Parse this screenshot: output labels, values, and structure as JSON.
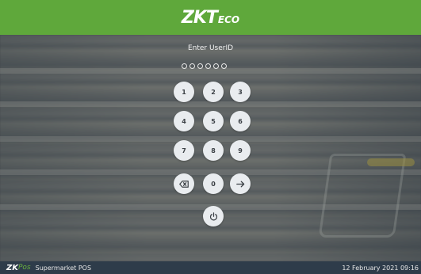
{
  "header": {
    "logo_main": "ZKT",
    "logo_sub": "ECO",
    "bg_color": "#5fa83b"
  },
  "login": {
    "title": "Enter UserID",
    "pin_length": 6
  },
  "keypad": {
    "keys": [
      "1",
      "2",
      "3",
      "4",
      "5",
      "6",
      "7",
      "8",
      "9"
    ],
    "zero": "0",
    "backspace_icon": "backspace-icon",
    "enter_icon": "arrow-right-icon",
    "power_icon": "power-icon"
  },
  "footer": {
    "brand_zk": "ZK",
    "brand_pos": "Pos",
    "app_name": "Supermarket POS",
    "datetime": "12 February 2021 09:16",
    "bg_color": "#2e3c4a"
  }
}
